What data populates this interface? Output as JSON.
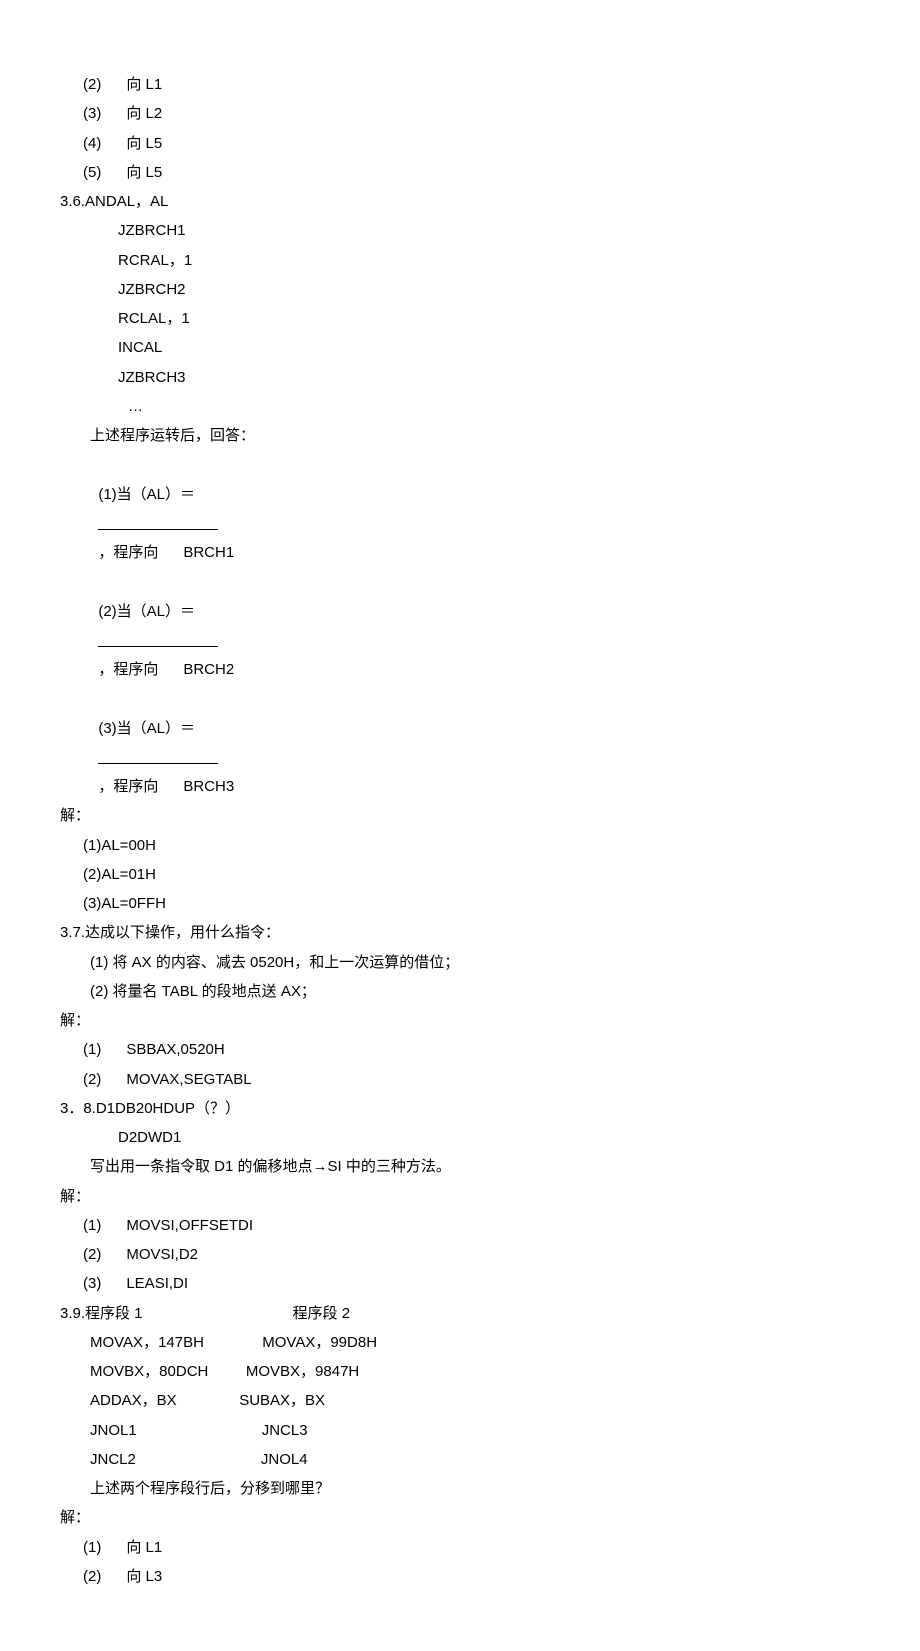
{
  "lines": {
    "l1": "(2)      向 L1",
    "l2": "(3)      向 L2",
    "l3": "(4)      向 L5",
    "l4": "(5)      向 L5",
    "l5": "3.6.ANDAL，AL",
    "l6": "JZBRCH1",
    "l7": "RCRAL，1",
    "l8": "JZBRCH2",
    "l9": "RCLAL，1",
    "l10": "INCAL",
    "l11": "JZBRCH3",
    "l12": "…",
    "l13": "上述程序运转后，回答：",
    "l14a": "(1)当（AL）＝",
    "l14b": "，程序向      BRCH1",
    "l15a": "(2)当（AL）＝",
    "l15b": "，程序向      BRCH2",
    "l16a": "(3)当（AL）＝",
    "l16b": "，程序向      BRCH3",
    "l17": "解：",
    "l18": "(1)AL=00H",
    "l19": "(2)AL=01H",
    "l20": "(3)AL=0FFH",
    "l21": "3.7.达成以下操作，用什么指令：",
    "l22": "(1) 将 AX 的内容、减去 0520H，和上一次运算的借位；",
    "l23": "(2) 将量名 TABL 的段地点送 AX；",
    "l24": "解：",
    "l25": "(1)      SBBAX,0520H",
    "l26": "(2)      MOVAX,SEGTABL",
    "l27": "3．8.D1DB20HDUP（？）",
    "l28": "D2DWD1",
    "l29": "写出用一条指令取 D1 的偏移地点→SI 中的三种方法。",
    "l30": "解：",
    "l31": "(1)      MOVSI,OFFSETDI",
    "l32": "(2)      MOVSI,D2",
    "l33": "(3)      LEASI,DI",
    "l34": "3.9.程序段 1                                    程序段 2",
    "l35": "MOVAX，147BH              MOVAX，99D8H",
    "l36": "MOVBX，80DCH         MOVBX，9847H",
    "l37": "ADDAX，BX               SUBAX，BX",
    "l38": "JNOL1                              JNCL3",
    "l39": "JNCL2                              JNOL4",
    "l40": "上述两个程序段行后，分移到哪里？",
    "l41": "解：",
    "l42": "(1)      向 L1",
    "l43": "(2)      向 L3"
  }
}
